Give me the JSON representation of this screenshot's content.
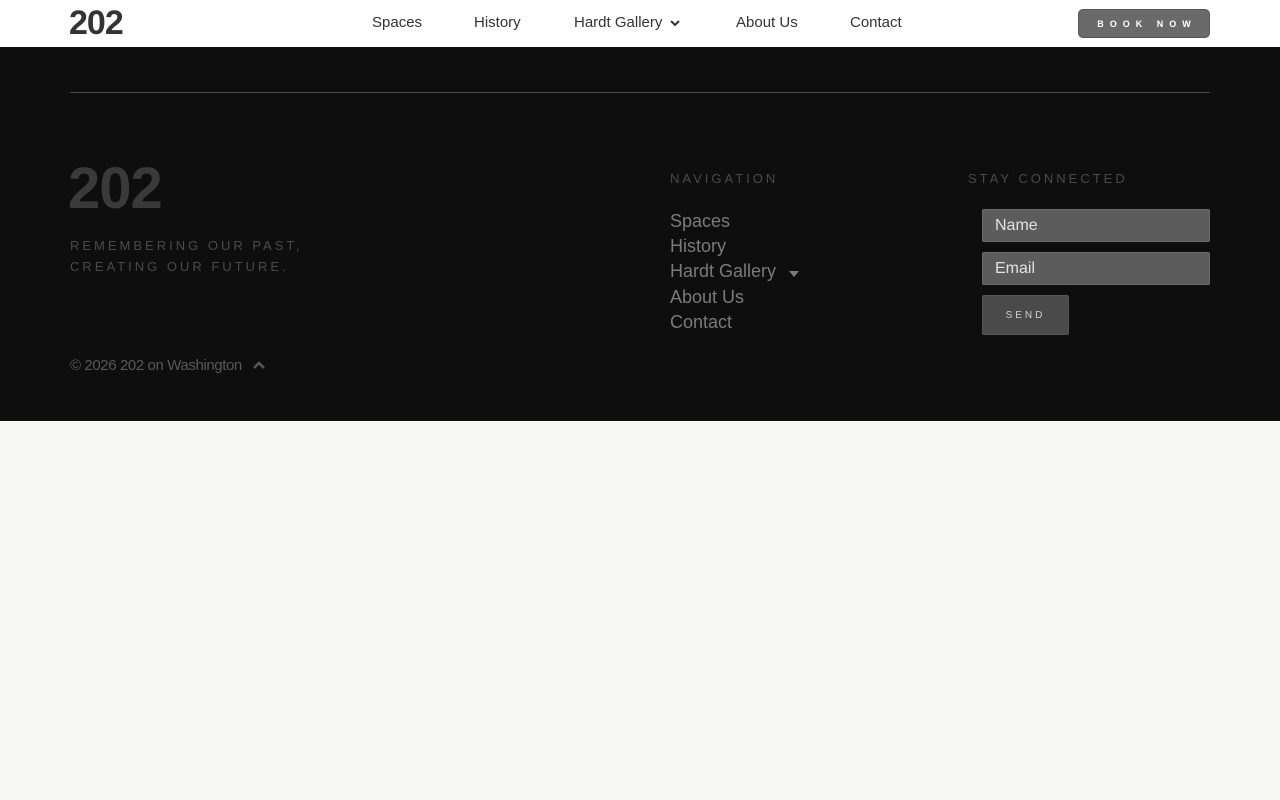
{
  "header": {
    "logo": "202",
    "nav": [
      {
        "label": "Spaces"
      },
      {
        "label": "History"
      },
      {
        "label": "Hardt Gallery"
      },
      {
        "label": "About Us"
      },
      {
        "label": "Contact"
      }
    ],
    "book_label": "BOOK NOW"
  },
  "footer": {
    "logo": "202",
    "tagline_line1": "REMEMBERING OUR PAST,",
    "tagline_line2": "CREATING OUR FUTURE.",
    "copyright": "© 2026 202 on Washington",
    "navigation_title": "NAVIGATION",
    "nav": [
      {
        "label": "Spaces"
      },
      {
        "label": "History"
      },
      {
        "label": "Hardt Gallery"
      },
      {
        "label": "About Us"
      },
      {
        "label": "Contact"
      }
    ],
    "stay_connected_title": "STAY CONNECTED",
    "name_placeholder": "Name",
    "email_placeholder": "Email",
    "send_label": "SEND"
  },
  "icons": {
    "nav_dropdown": "chevron-down-icon",
    "footer_dropdown": "caret-down-icon",
    "back_to_top": "chevron-up-icon"
  },
  "colors": {
    "header_bg": "#ffffff",
    "footer_bg": "#0e0e0e",
    "book_button_bg": "#6a6a6a",
    "page_bg": "#f6f6f2"
  }
}
